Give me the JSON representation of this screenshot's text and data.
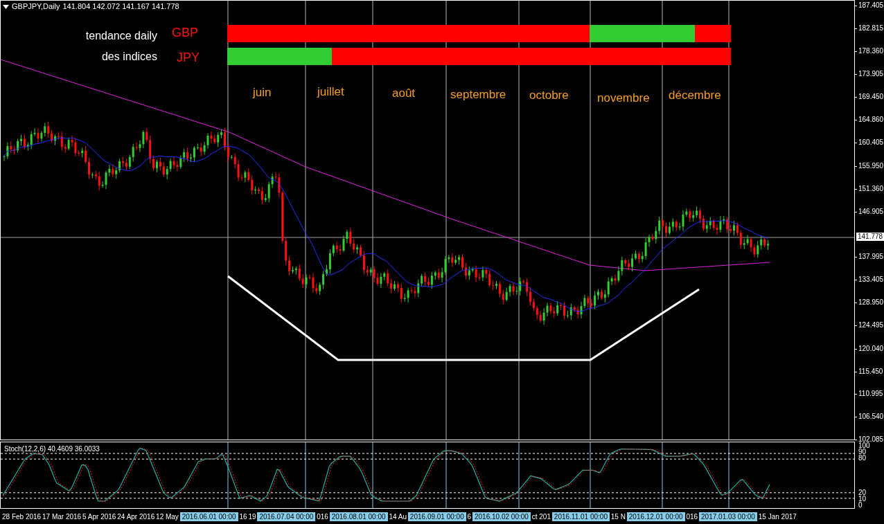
{
  "chart": {
    "symbol": "GBPJPY,Daily",
    "ohlc": "141.804 142.072 141.167 141.778"
  },
  "legend": {
    "rows": [
      {
        "label": "tendance daily",
        "currency": "GBP",
        "segments": [
          {
            "color": "#ff0000"
          },
          {
            "color": "#32cd32"
          },
          {
            "color": "#ff0000"
          }
        ]
      },
      {
        "label": "des indices",
        "currency": "JPY",
        "segments": [
          {
            "color": "#32cd32"
          },
          {
            "color": "#ff0000"
          }
        ]
      }
    ]
  },
  "months": [
    "juin",
    "juillet",
    "août",
    "septembre",
    "octobre",
    "novembre",
    "décembre"
  ],
  "price_axis": {
    "ticks": [
      "187.405",
      "182.815",
      "178.360",
      "173.905",
      "169.450",
      "164.860",
      "160.405",
      "155.950",
      "151.360",
      "146.905",
      "137.995",
      "133.405",
      "128.950",
      "124.495",
      "120.040",
      "115.450",
      "110.995",
      "106.540",
      "102.085"
    ],
    "current_price": "141.778"
  },
  "stochastic": {
    "title": "Stoch(12,2,6) 40.4609 36.0033",
    "levels": [
      "100",
      "90",
      "80",
      "20",
      "10",
      "0"
    ]
  },
  "time_axis": {
    "labels": [
      {
        "text": "28 Feb 2016",
        "highlighted": false
      },
      {
        "text": "17 Mar 2016",
        "highlighted": false
      },
      {
        "text": "5 Apr 2016",
        "highlighted": false
      },
      {
        "text": "24 Apr 2016",
        "highlighted": false
      },
      {
        "text": "12 May",
        "highlighted": false
      },
      {
        "text": "2016.06.01 00:00",
        "highlighted": true
      },
      {
        "text": "16",
        "highlighted": false
      },
      {
        "text": "19",
        "highlighted": false
      },
      {
        "text": "2016.07.04 00:00",
        "highlighted": true
      },
      {
        "text": "016",
        "highlighted": false
      },
      {
        "text": "2016.08.01 00:00",
        "highlighted": true
      },
      {
        "text": "14 Au",
        "highlighted": false
      },
      {
        "text": "2016.09.01 00:00",
        "highlighted": true
      },
      {
        "text": "6",
        "highlighted": false
      },
      {
        "text": "2016.10.02 00:00",
        "highlighted": true
      },
      {
        "text": "ct 201",
        "highlighted": false
      },
      {
        "text": "2016.11.01 00:00",
        "highlighted": true
      },
      {
        "text": "15 N",
        "highlighted": false
      },
      {
        "text": "2016.12.01 00:00",
        "highlighted": true
      },
      {
        "text": "016",
        "highlighted": false
      },
      {
        "text": "2017.01.03 00:00",
        "highlighted": true
      },
      {
        "text": "15 Jan 2017",
        "highlighted": false
      }
    ]
  }
}
